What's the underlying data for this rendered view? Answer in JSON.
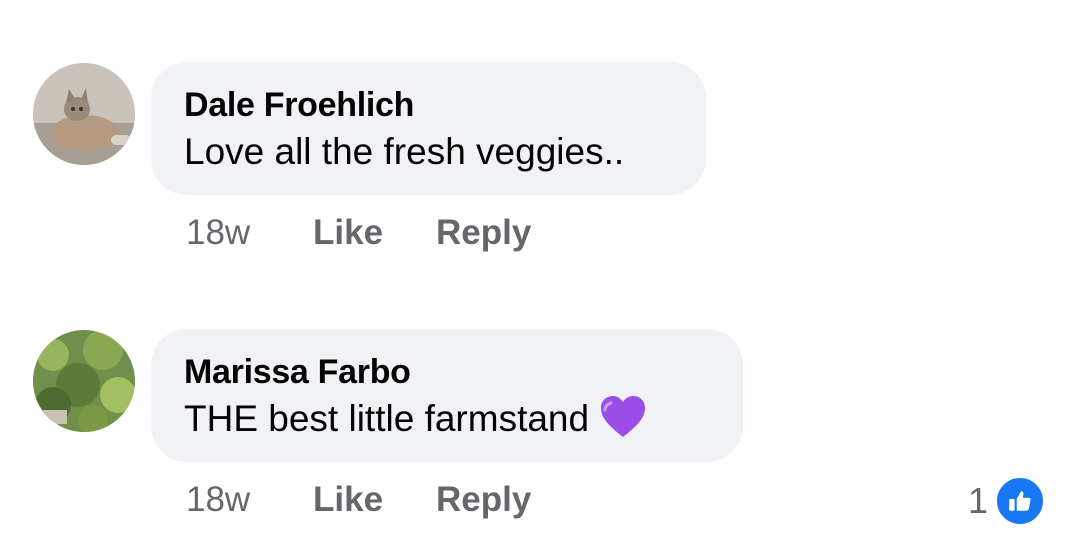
{
  "comments": [
    {
      "author": "Dale Froehlich",
      "text": "Love all the fresh veggies..",
      "time": "18w",
      "like_label": "Like",
      "reply_label": "Reply"
    },
    {
      "author": "Marissa Farbo",
      "text": "THE best little farmstand",
      "time": "18w",
      "like_label": "Like",
      "reply_label": "Reply",
      "emoji": "purple-heart",
      "reaction_count": "1",
      "reaction_type": "like"
    }
  ],
  "colors": {
    "bubble_bg": "#f0f2f5",
    "meta_text": "#65676b",
    "like_blue": "#1877f2",
    "heart_purple": "#9b4de8"
  }
}
